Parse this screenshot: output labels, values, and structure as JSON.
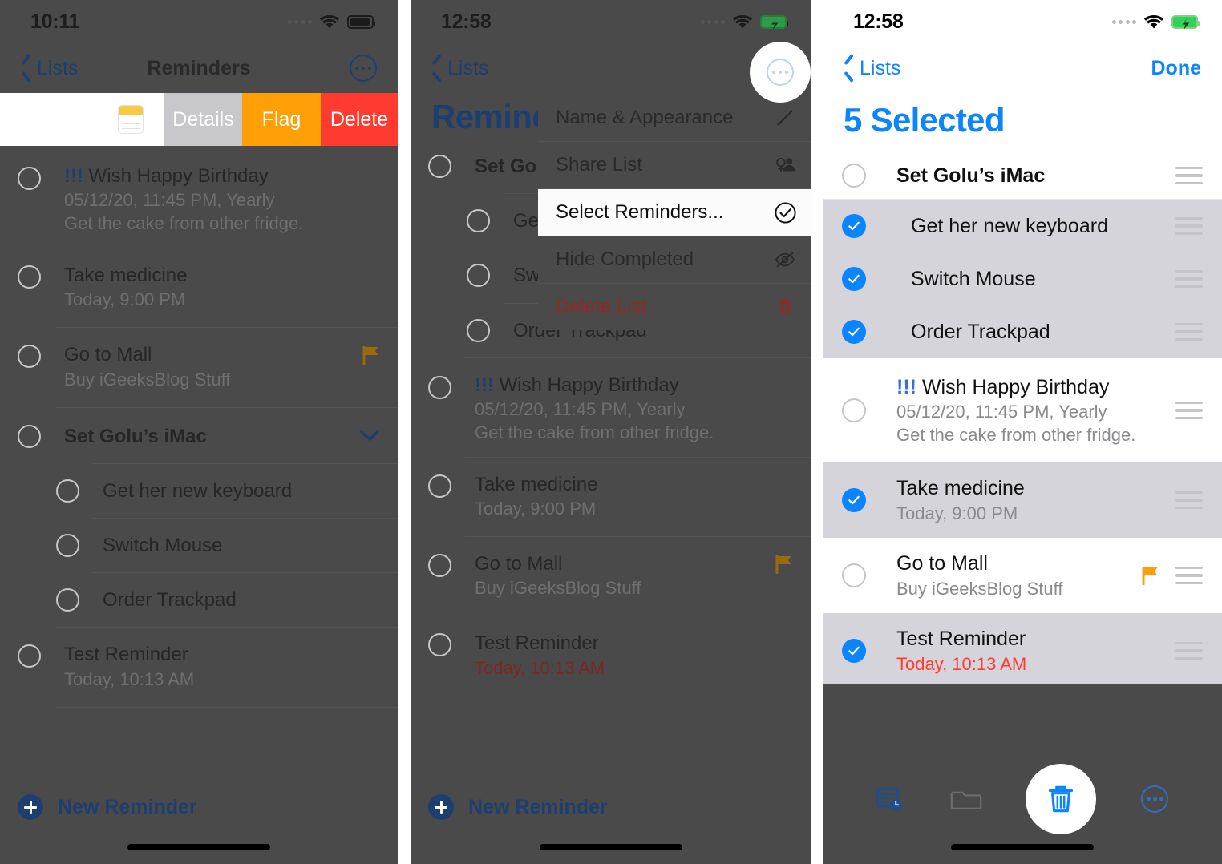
{
  "panels": [
    {
      "id": "panel-swipe-actions",
      "status": {
        "time": "10:11",
        "wifi": "wifi-icon",
        "battery": "battery-icon",
        "signal": "signal-dots"
      },
      "nav": {
        "back": "Lists",
        "title": "Reminders",
        "more": "more-options-icon"
      },
      "swipe": {
        "note_icon": "note-icon",
        "details": "Details",
        "flag": "Flag",
        "delete": "Delete",
        "colors": {
          "details": "#c7c7cc",
          "flag": "#ff9f08",
          "delete": "#ff3b30"
        }
      },
      "rows": [
        {
          "title": "Wish Happy Birthday",
          "priority": "!!!",
          "sub1": "05/12/20, 11:45 PM, Yearly",
          "sub2": "Get the cake from other fridge.",
          "flagged": false,
          "indent": false,
          "bold": false
        },
        {
          "title": "Take medicine",
          "sub1": "Today, 9:00 PM",
          "flagged": false,
          "indent": false,
          "bold": false
        },
        {
          "title": "Go to Mall",
          "sub1": "Buy iGeeksBlog Stuff",
          "flagged": true,
          "indent": false,
          "bold": false
        },
        {
          "title": "Set Golu’s iMac",
          "chevron": true,
          "indent": false,
          "bold": true
        },
        {
          "title": "Get her new keyboard",
          "indent": true,
          "bold": false
        },
        {
          "title": "Switch Mouse",
          "indent": true,
          "bold": false
        },
        {
          "title": "Order Trackpad",
          "indent": true,
          "bold": false
        },
        {
          "title": "Test Reminder",
          "sub1": "Today, 10:13 AM",
          "indent": false,
          "bold": false
        }
      ],
      "new_reminder": "New Reminder"
    },
    {
      "id": "panel-context-menu",
      "status": {
        "time": "12:58",
        "wifi": "wifi-icon",
        "battery": "battery-charging-icon",
        "signal": "signal-dots"
      },
      "nav": {
        "back": "Lists",
        "title": "Reminders",
        "more": "more-options-icon"
      },
      "big_title": "Reminders",
      "menu": [
        {
          "label": "Name & Appearance",
          "icon": "pencil-icon",
          "highlighted": false,
          "destructive": false
        },
        {
          "label": "Share List",
          "icon": "share-person-icon",
          "highlighted": false,
          "destructive": false
        },
        {
          "label": "Select Reminders...",
          "icon": "check-circle-icon",
          "highlighted": true,
          "destructive": false
        },
        {
          "label": "Hide Completed",
          "icon": "eye-slash-icon",
          "highlighted": false,
          "destructive": false
        },
        {
          "label": "Delete List",
          "icon": "trash-icon",
          "highlighted": false,
          "destructive": true
        }
      ],
      "rows": [
        {
          "title": "Set Golu’s iMac",
          "indent": false,
          "bold": true
        },
        {
          "title": "Get her new keyboard",
          "indent": true,
          "bold": false
        },
        {
          "title": "Switch Mouse",
          "indent": true,
          "bold": false
        },
        {
          "title": "Order Trackpad",
          "indent": true,
          "bold": false
        },
        {
          "title": "Wish Happy Birthday",
          "priority": "!!!",
          "sub1": "05/12/20, 11:45 PM, Yearly",
          "sub2": "Get the cake from other fridge.",
          "indent": false,
          "bold": false
        },
        {
          "title": "Take medicine",
          "sub1": "Today, 9:00 PM",
          "indent": false,
          "bold": false
        },
        {
          "title": "Go to Mall",
          "sub1": "Buy iGeeksBlog Stuff",
          "flagged": true,
          "indent": false,
          "bold": false
        },
        {
          "title": "Test Reminder",
          "sub1": "Today, 10:13 AM",
          "overdue": true,
          "indent": false,
          "bold": false
        }
      ],
      "new_reminder": "New Reminder"
    },
    {
      "id": "panel-selection-mode",
      "status": {
        "time": "12:58",
        "wifi": "wifi-icon",
        "battery": "battery-charging-icon",
        "signal": "signal-dots"
      },
      "nav": {
        "back": "Lists",
        "done": "Done"
      },
      "heading": "5 Selected",
      "rows": [
        {
          "title": "Set Golu’s iMac",
          "selected": false,
          "bold": true,
          "indent": false
        },
        {
          "title": "Get her new keyboard",
          "selected": true,
          "bold": false,
          "indent": true
        },
        {
          "title": "Switch Mouse",
          "selected": true,
          "bold": false,
          "indent": true
        },
        {
          "title": "Order Trackpad",
          "selected": true,
          "bold": false,
          "indent": true
        },
        {
          "title": "Wish Happy Birthday",
          "priority": "!!!",
          "sub1": "05/12/20, 11:45 PM, Yearly",
          "sub2": "Get the cake from other fridge.",
          "selected": false,
          "bold": false,
          "indent": false
        },
        {
          "title": "Take medicine",
          "sub1": "Today, 9:00 PM",
          "selected": true,
          "bold": false,
          "indent": false
        },
        {
          "title": "Go to Mall",
          "sub1": "Buy iGeeksBlog Stuff",
          "flagged": true,
          "selected": false,
          "bold": false,
          "indent": false
        },
        {
          "title": "Test Reminder",
          "sub1": "Today, 10:13 AM",
          "overdue": true,
          "selected": true,
          "bold": false,
          "indent": false
        }
      ],
      "toolbar": [
        {
          "icon": "calendar-clock-icon",
          "name": "set-date-time-button"
        },
        {
          "icon": "folder-icon",
          "name": "move-to-list-button"
        },
        {
          "icon": "trash-icon",
          "name": "delete-selected-button"
        },
        {
          "icon": "more-options-icon",
          "name": "more-actions-button"
        }
      ]
    }
  ],
  "colors": {
    "accent_blue": "#0b84ff",
    "dim_overlay": "#4a4a4a",
    "flag_orange": "#ff9f08",
    "delete_red": "#ff3b30",
    "selected_row": "#d4d4da"
  }
}
